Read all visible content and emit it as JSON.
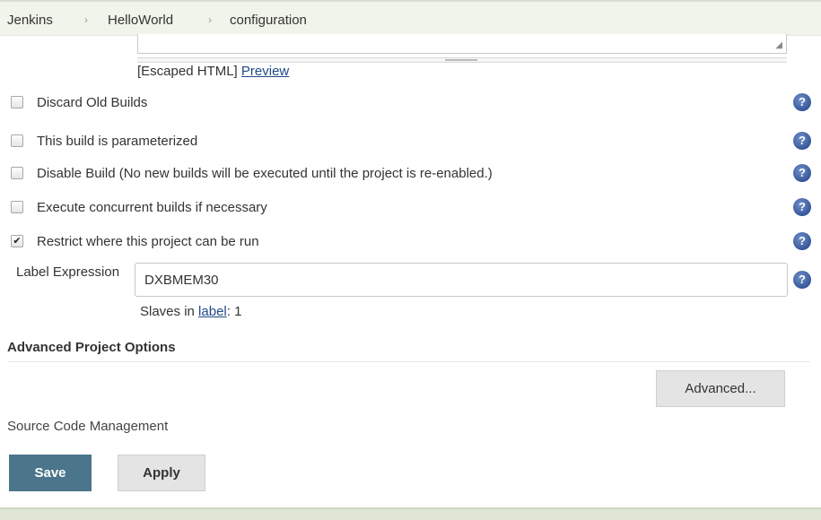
{
  "breadcrumb": {
    "items": [
      "Jenkins",
      "HelloWorld",
      "configuration"
    ],
    "separator": "›"
  },
  "description": {
    "markup_prefix": "[Escaped HTML]",
    "preview_label": "Preview",
    "resize_glyph": "◢"
  },
  "options": [
    {
      "label": "Discard Old Builds",
      "checked": false
    },
    {
      "label": "This build is parameterized",
      "checked": false
    },
    {
      "label": "Disable Build (No new builds will be executed until the project is re-enabled.)",
      "checked": false
    },
    {
      "label": "Execute concurrent builds if necessary",
      "checked": false
    },
    {
      "label": "Restrict where this project can be run",
      "checked": true,
      "check_glyph": "✔"
    }
  ],
  "label_expression": {
    "label": "Label Expression",
    "value": "DXBMEM30"
  },
  "slaves": {
    "prefix": "Slaves in ",
    "link": "label",
    "suffix": ": 1"
  },
  "advanced_section": {
    "title": "Advanced Project Options",
    "button": "Advanced..."
  },
  "scm": {
    "title": "Source Code Management"
  },
  "actions": {
    "save": "Save",
    "apply": "Apply"
  },
  "help_glyph": "?",
  "colors": {
    "save_button": "#4b758b",
    "link": "#204a87",
    "breadcrumb_bg": "#f0f4ea",
    "help_icon": "#1f3f87"
  }
}
